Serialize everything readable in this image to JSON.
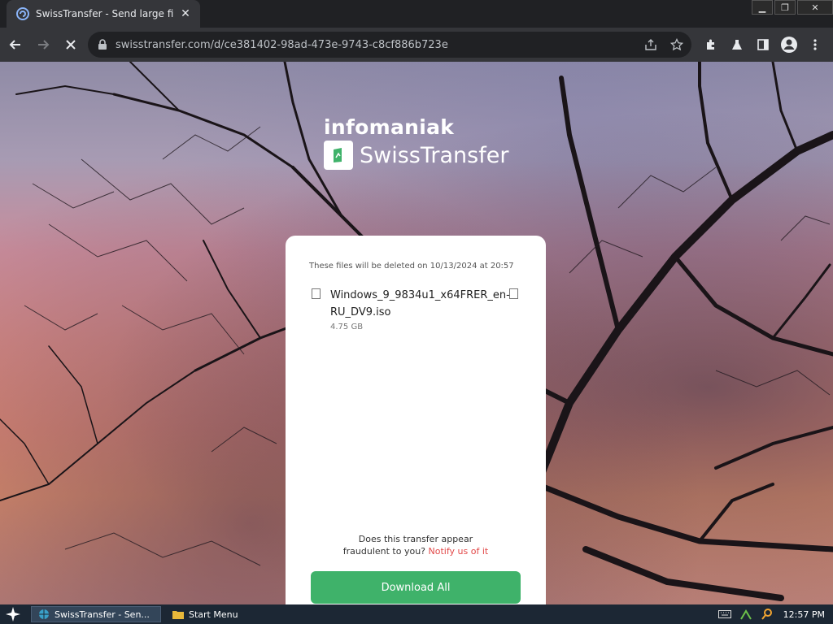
{
  "browser": {
    "tab_title": "SwissTransfer - Send large files sec",
    "url": "swisstransfer.com/d/ce381402-98ad-473e-9743-c8cf886b723e"
  },
  "page": {
    "brand_company": "infomaniak",
    "brand_product": "SwissTransfer",
    "expiry_text": "These files will be deleted on 10/13/2024 at 20:57",
    "file": {
      "name": "Windows_9_9834u1_x64FRER_en-RU_DV9.iso",
      "size": "4.75 GB"
    },
    "fraud_text_line1": "Does this transfer appear",
    "fraud_text_line2": "fraudulent to you?",
    "fraud_link": "Notify us of it",
    "download_label": "Download All"
  },
  "taskbar": {
    "items": [
      {
        "label": "SwissTransfer - Sen..."
      },
      {
        "label": "Start Menu"
      }
    ],
    "clock": "12:57 PM"
  },
  "colors": {
    "accent_green": "#3fb26a",
    "link_red": "#e24848"
  }
}
